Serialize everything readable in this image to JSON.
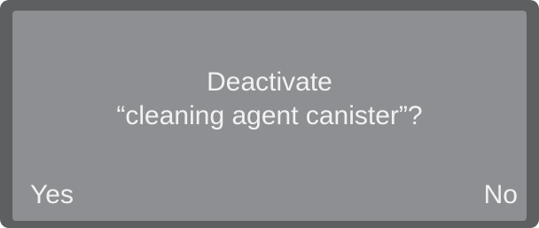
{
  "dialog": {
    "line1": "Deactivate",
    "line2": "“cleaning agent canister”?",
    "yes_label": "Yes",
    "no_label": "No"
  },
  "colors": {
    "bezel": "#5e5f61",
    "screen": "#8e8f92",
    "text": "#f2f2f2"
  }
}
